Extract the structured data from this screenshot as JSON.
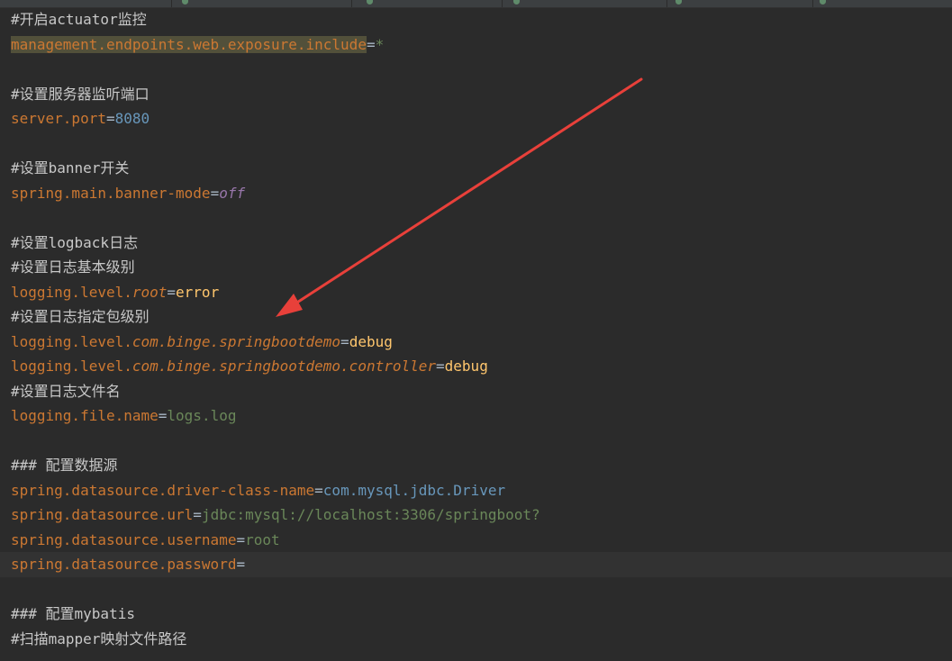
{
  "editor": {
    "tabs": [
      {
        "label": ""
      },
      {
        "label": ""
      },
      {
        "label": ""
      },
      {
        "label": ""
      },
      {
        "label": ""
      },
      {
        "label": ""
      }
    ],
    "lines": [
      {
        "comment": "#开启actuator监控"
      },
      {
        "key": "management.endpoints.web.exposure.include",
        "eq": "=",
        "value": "*",
        "highlight": true
      },
      {
        "blank": true
      },
      {
        "comment": "#设置服务器监听端口"
      },
      {
        "key": "server.port",
        "eq": "=",
        "value": "8080"
      },
      {
        "blank": true
      },
      {
        "comment": "#设置banner开关"
      },
      {
        "key": "spring.main.banner-mode",
        "eq": "=",
        "value": "off"
      },
      {
        "blank": true
      },
      {
        "comment": "#设置logback日志"
      },
      {
        "comment": "#设置日志基本级别"
      },
      {
        "key_prefix": "logging.level.",
        "key_italic": "root",
        "eq": "=",
        "value": "error"
      },
      {
        "comment": "#设置日志指定包级别"
      },
      {
        "key_prefix": "logging.level.",
        "key_italic": "com.binge.springbootdemo",
        "eq": "=",
        "value": "debug"
      },
      {
        "key_prefix": "logging.level.",
        "key_italic": "com.binge.springbootdemo.controller",
        "eq": "=",
        "value": "debug"
      },
      {
        "comment": "#设置日志文件名"
      },
      {
        "key": "logging.file.name",
        "eq": "=",
        "value": "logs.log"
      },
      {
        "blank": true
      },
      {
        "comment": "### 配置数据源"
      },
      {
        "key": "spring.datasource.driver-class-name",
        "eq": "=",
        "value_pkg": "com.mysql.jdbc.",
        "value": "Driver"
      },
      {
        "key": "spring.datasource.url",
        "eq": "=",
        "value": "jdbc:mysql://localhost:3306/springboot?"
      },
      {
        "key": "spring.datasource.username",
        "eq": "=",
        "value": "root"
      },
      {
        "key": "spring.datasource.password",
        "eq": "=",
        "value": "",
        "current": true
      },
      {
        "blank": true
      },
      {
        "comment": "### 配置mybatis"
      },
      {
        "comment": "#扫描mapper映射文件路径"
      }
    ]
  },
  "colors": {
    "background": "#2b2b2b",
    "comment": "#c8c8c8",
    "key": "#cc7832",
    "number": "#6897bb",
    "keyword": "#9876aa",
    "value": "#ffc66d",
    "string": "#6a8759",
    "arrow": "#e8403a"
  }
}
